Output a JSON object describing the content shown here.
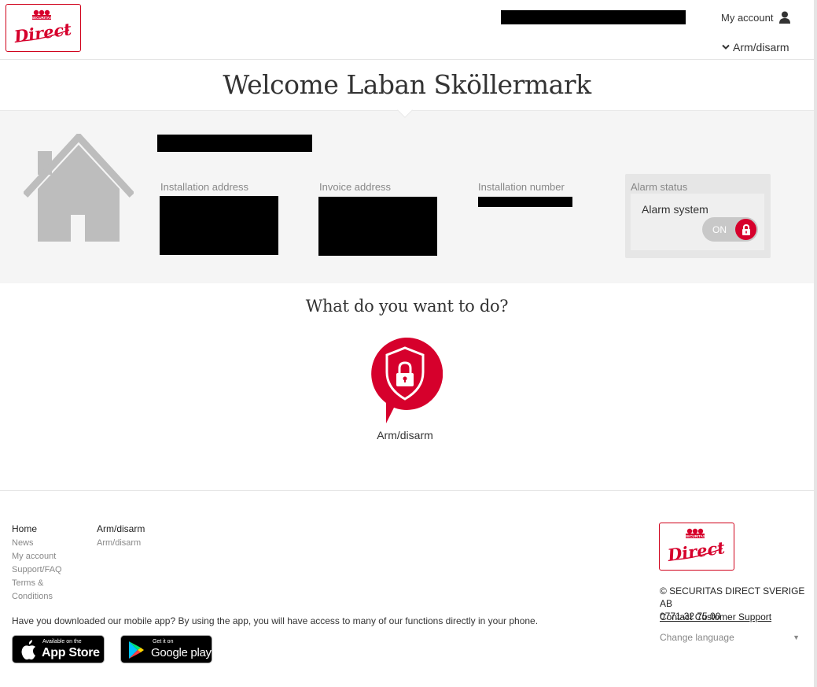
{
  "header": {
    "my_account_label": "My account",
    "arm_disarm_nav_label": "Arm/disarm"
  },
  "welcome": {
    "title": "Welcome Laban Sköllermark"
  },
  "installation": {
    "installation_address_label": "Installation address",
    "invoice_address_label": "Invoice address",
    "installation_number_label": "Installation number"
  },
  "alarm": {
    "status_label": "Alarm status",
    "system_label": "Alarm system",
    "toggle_text": "ON",
    "state": "armed"
  },
  "actions": {
    "title": "What do you want to do?",
    "arm_disarm_label": "Arm/disarm"
  },
  "footer": {
    "col1": {
      "head": "Home",
      "links": [
        "News",
        "My account",
        "Support/FAQ",
        "Terms &",
        "Conditions"
      ]
    },
    "col2": {
      "head": "Arm/disarm",
      "links": [
        "Arm/disarm"
      ]
    },
    "app_text": "Have you downloaded our mobile app? By using the app, you will have access to many of our functions directly in your phone.",
    "app_store": {
      "small": "Available on the",
      "big": "App Store"
    },
    "google_play": {
      "small": "Get it on",
      "big": "Google play"
    },
    "copyright": "© SECURITAS DIRECT SVERIGE AB",
    "phone": "0771-32 75 00",
    "support_link": "Contact Customer Support",
    "language_label": "Change language"
  },
  "logo": {
    "top_text": "SECURITAS",
    "script_text": "Direct"
  },
  "colors": {
    "brand_red": "#d6002c",
    "band_gray": "#f5f5f5",
    "house_gray": "#bdbdbd"
  }
}
